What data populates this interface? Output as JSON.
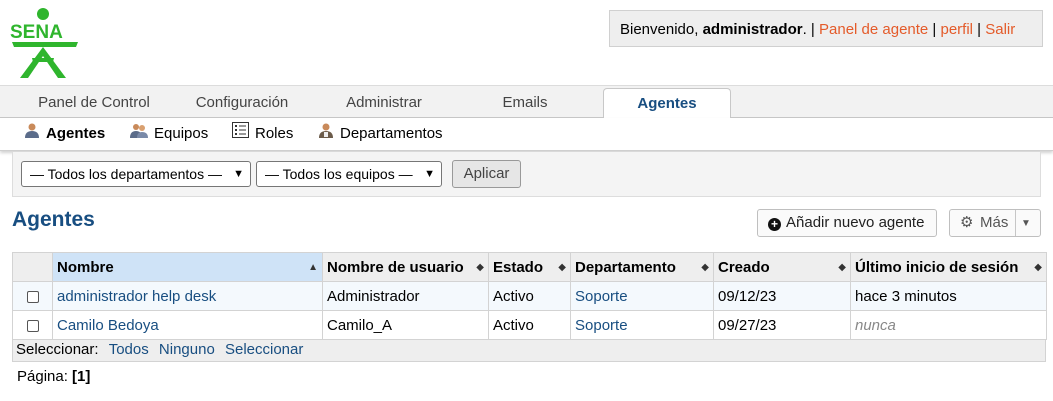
{
  "brand": {
    "logo_text": "SENA",
    "logo_color": "#2fb52d"
  },
  "user_info": {
    "welcome": "Bienvenido, ",
    "username": "administrador",
    "suffix": ". | ",
    "panel_link": "Panel de agente",
    "sep1": " | ",
    "profile_link": "perfil",
    "sep2": " | ",
    "logout_link": "Salir"
  },
  "nav": {
    "tabs": [
      {
        "label": "Panel de Control"
      },
      {
        "label": "Configuración"
      },
      {
        "label": "Administrar"
      },
      {
        "label": "Emails"
      },
      {
        "label": "Agentes",
        "active": true
      }
    ]
  },
  "subnav": {
    "items": [
      {
        "label": "Agentes",
        "icon": "agent-icon",
        "active": true
      },
      {
        "label": "Equipos",
        "icon": "team-icon"
      },
      {
        "label": "Roles",
        "icon": "roles-icon"
      },
      {
        "label": "Departamentos",
        "icon": "department-icon"
      }
    ]
  },
  "filters": {
    "department": "— Todos los departamentos —",
    "team": "— Todos los equipos —",
    "apply": "Aplicar"
  },
  "page": {
    "title": "Agentes",
    "add_button": "Añadir nuevo agente",
    "more_button": "Más"
  },
  "table": {
    "columns": [
      "Nombre",
      "Nombre de usuario",
      "Estado",
      "Departamento",
      "Creado",
      "Último inicio de sesión"
    ],
    "rows": [
      {
        "name": "administrador help desk",
        "username": "Administrador",
        "status": "Activo",
        "department": "Soporte",
        "created": "09/12/23",
        "last_login": "hace 3 minutos"
      },
      {
        "name": "Camilo Bedoya",
        "username": "Camilo_A",
        "status": "Activo",
        "department": "Soporte",
        "created": "09/27/23",
        "last_login": "nunca"
      }
    ],
    "select_label": "Seleccionar:",
    "select_all": "Todos",
    "select_none": "Ninguno",
    "select_toggle": "Seleccionar"
  },
  "pager": {
    "label": "Página:",
    "current": "[1]"
  },
  "colors": {
    "accent": "#184e81",
    "link_orange": "#e45b2a",
    "sorted_header": "#cfe3f7"
  }
}
